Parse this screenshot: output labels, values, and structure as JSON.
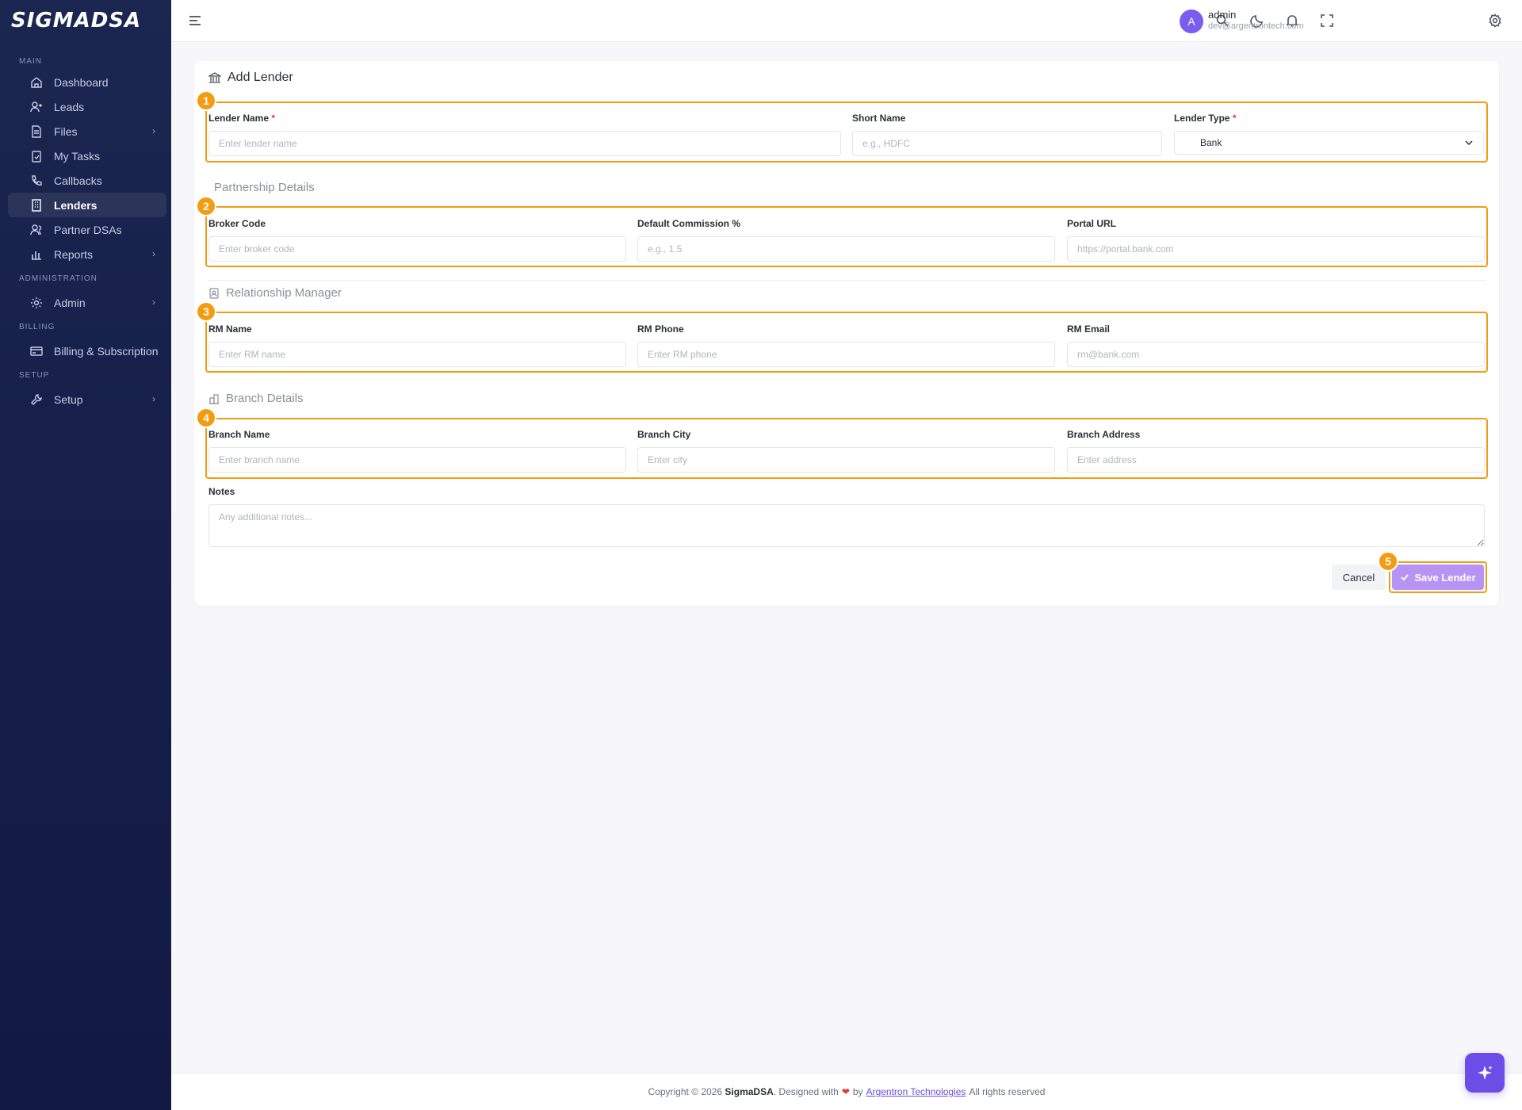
{
  "brand": {
    "logo_text": "SIGMADSA"
  },
  "sidebar": {
    "sections": [
      {
        "title": "MAIN"
      },
      {
        "title": "ADMINISTRATION"
      },
      {
        "title": "BILLING"
      },
      {
        "title": "SETUP"
      }
    ],
    "items": [
      {
        "label": "Dashboard",
        "icon": "home-icon"
      },
      {
        "label": "Leads",
        "icon": "user-plus-icon"
      },
      {
        "label": "Files",
        "icon": "file-icon",
        "has_submenu": true
      },
      {
        "label": "My Tasks",
        "icon": "clipboard-check-icon"
      },
      {
        "label": "Callbacks",
        "icon": "phone-icon"
      },
      {
        "label": "Lenders",
        "icon": "building-icon",
        "active": true
      },
      {
        "label": "Partner DSAs",
        "icon": "users-icon"
      },
      {
        "label": "Reports",
        "icon": "bar-chart-icon",
        "has_submenu": true
      },
      {
        "label": "Admin",
        "icon": "gear-icon",
        "has_submenu": true
      },
      {
        "label": "Billing & Subscription",
        "icon": "credit-card-icon"
      },
      {
        "label": "Setup",
        "icon": "wrench-icon",
        "has_submenu": true
      }
    ]
  },
  "topbar": {
    "user": {
      "initial": "A",
      "name": "admin",
      "email": "dev@argentrontech.com"
    },
    "avatar_color": "#7b5cf0"
  },
  "form": {
    "title": "Add Lender",
    "badges": [
      "1",
      "2",
      "3",
      "4",
      "5"
    ],
    "lender_name": {
      "label": "Lender Name",
      "required_mark": "*",
      "placeholder": "Enter lender name"
    },
    "short_name": {
      "label": "Short Name",
      "placeholder": "e.g., HDFC"
    },
    "lender_type": {
      "label": "Lender Type",
      "required_mark": "*",
      "value": "Bank"
    },
    "partnership_title": "Partnership Details",
    "broker_code": {
      "label": "Broker Code",
      "placeholder": "Enter broker code"
    },
    "default_commission": {
      "label": "Default Commission %",
      "placeholder": "e.g., 1.5"
    },
    "portal_url": {
      "label": "Portal URL",
      "placeholder": "https://portal.bank.com"
    },
    "rm_title": "Relationship Manager",
    "rm_name": {
      "label": "RM Name",
      "placeholder": "Enter RM name"
    },
    "rm_phone": {
      "label": "RM Phone",
      "placeholder": "Enter RM phone"
    },
    "rm_email": {
      "label": "RM Email",
      "placeholder": "rm@bank.com"
    },
    "branch_title": "Branch Details",
    "branch_name": {
      "label": "Branch Name",
      "placeholder": "Enter branch name"
    },
    "branch_city": {
      "label": "Branch City",
      "placeholder": "Enter city"
    },
    "branch_address": {
      "label": "Branch Address",
      "placeholder": "Enter address"
    },
    "notes": {
      "label": "Notes",
      "placeholder": "Any additional notes..."
    },
    "cancel_label": "Cancel",
    "save_label": "Save Lender"
  },
  "footer": {
    "prefix": "Copyright © 2026",
    "brand": "SigmaDSA",
    "designed": ". Designed with",
    "by": "by",
    "company": "Argentron Technologies",
    "suffix": "All rights reserved"
  },
  "colors": {
    "highlight": "#f39c12",
    "accent": "#6c4de6",
    "save_button": "#b794f4",
    "sidebar": "#16204a"
  }
}
